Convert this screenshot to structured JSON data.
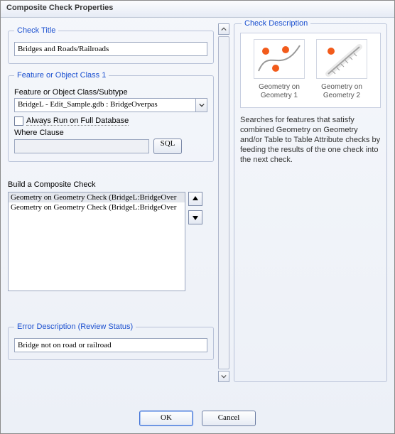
{
  "window": {
    "title": "Composite Check Properties"
  },
  "left": {
    "checkTitle": {
      "legend": "Check Title",
      "value": "Bridges and Roads/Railroads"
    },
    "feature1": {
      "legend": "Feature or Object Class 1",
      "subtype_label": "Feature or Object Class/Subtype",
      "dropdown_value": "BridgeL -  Edit_Sample.gdb : BridgeOverpas",
      "always_run": "Always Run on Full Database",
      "where_label": "Where Clause",
      "sql_btn": "SQL"
    },
    "composite": {
      "label": "Build a Composite Check",
      "rows": [
        "Geometry on Geometry Check (BridgeL:BridgeOver",
        "Geometry on Geometry Check (BridgeL:BridgeOver"
      ]
    },
    "error": {
      "legend": "Error Description (Review Status)",
      "value": "Bridge not on road or railroad"
    }
  },
  "right": {
    "legend": "Check Description",
    "thumb1": "Geometry on Geometry 1",
    "thumb2": "Geometry on Geometry 2",
    "text": "Searches for features that satisfy combined Geometry on Geometry and/or Table to Table Attribute checks by feeding the results of the one check into the next check."
  },
  "buttons": {
    "ok": "OK",
    "cancel": "Cancel"
  }
}
